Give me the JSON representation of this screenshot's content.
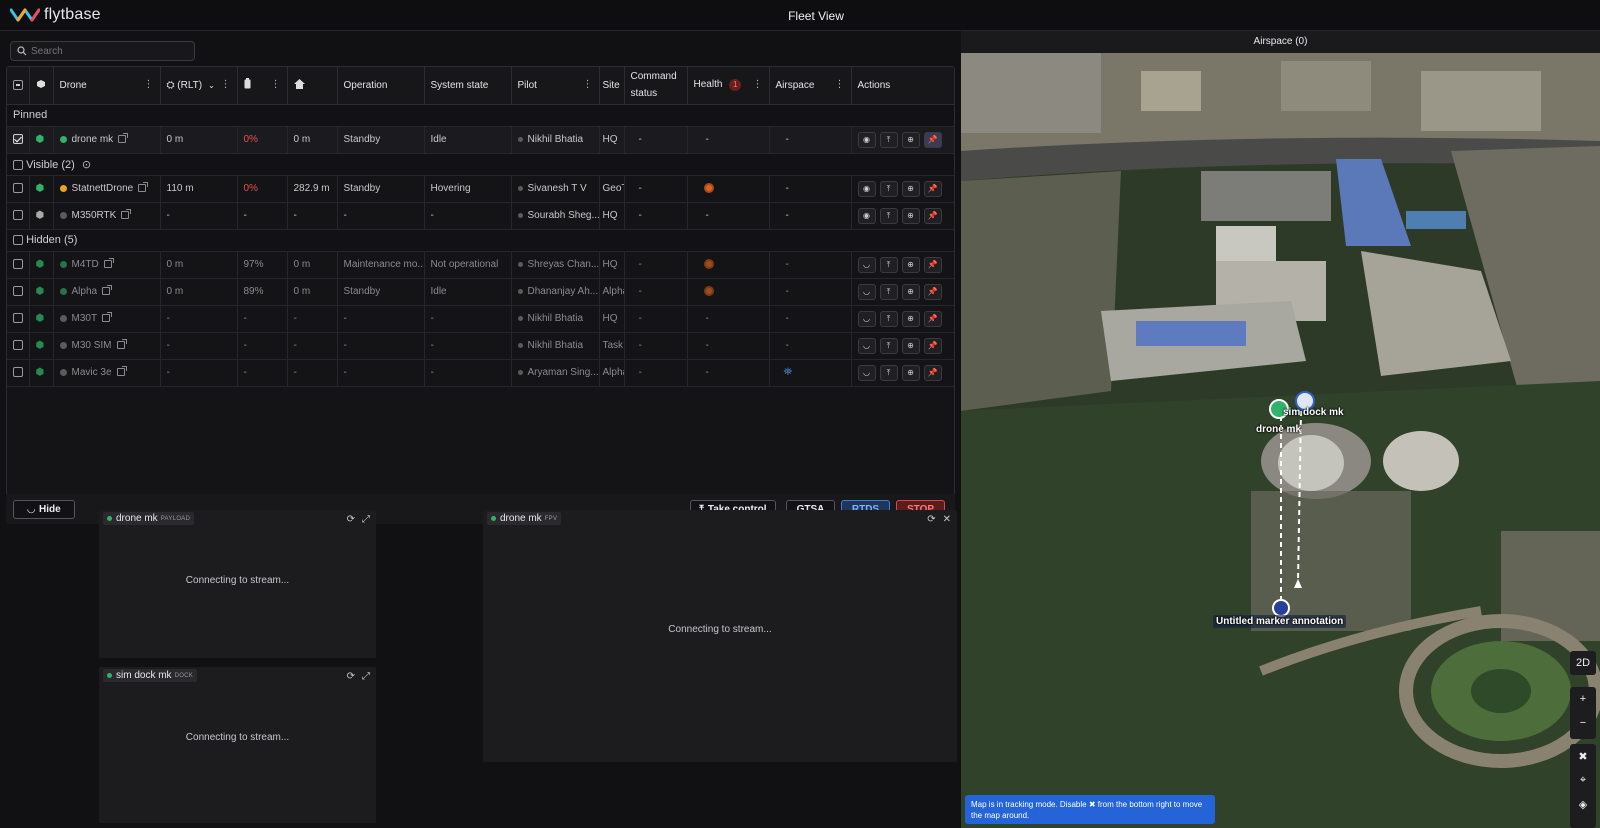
{
  "app": {
    "brand": "flytbase",
    "title": "Fleet View"
  },
  "search": {
    "placeholder": "Search"
  },
  "table": {
    "headers": {
      "drone": "Drone",
      "altitude": "(RLT)",
      "operation": "Operation",
      "system_state": "System state",
      "pilot": "Pilot",
      "site": "Site",
      "command_status": "Command status",
      "health": "Health",
      "health_badge": "1",
      "airspace": "Airspace",
      "actions": "Actions"
    },
    "groups": {
      "pinned": "Pinned",
      "visible": "Visible (2)",
      "hidden": "Hidden (5)"
    },
    "pinned_rows": [
      {
        "name": "drone mk",
        "alt": "0 m",
        "battery": "0%",
        "home": "0 m",
        "operation": "Standby",
        "state": "Idle",
        "pilot": "Nikhil Bhatia",
        "site": "HQ",
        "command": "-",
        "health": "-",
        "airspace": "-"
      }
    ],
    "visible_rows": [
      {
        "name": "StatnettDrone",
        "alt": "110 m",
        "battery": "0%",
        "home": "282.9 m",
        "operation": "Standby",
        "state": "Hovering",
        "pilot": "Sivanesh T V",
        "site": "GeoT",
        "command": "-",
        "health": "",
        "airspace": "-"
      },
      {
        "name": "M350RTK",
        "alt": "-",
        "battery": "-",
        "home": "-",
        "operation": "-",
        "state": "-",
        "pilot": "Sourabh Sheg...",
        "site": "HQ",
        "command": "-",
        "health": "-",
        "airspace": "-"
      }
    ],
    "hidden_rows": [
      {
        "name": "M4TD",
        "alt": "0 m",
        "battery": "97%",
        "home": "0 m",
        "operation": "Maintenance mo...",
        "state": "Not operational",
        "pilot": "Shreyas Chan...",
        "site": "HQ",
        "command": "-",
        "health": "",
        "airspace": "-"
      },
      {
        "name": "Alpha",
        "alt": "0 m",
        "battery": "89%",
        "home": "0 m",
        "operation": "Standby",
        "state": "Idle",
        "pilot": "Dhananjay Ah...",
        "site": "Alpha",
        "command": "-",
        "health": "",
        "airspace": "-"
      },
      {
        "name": "M30T",
        "alt": "-",
        "battery": "-",
        "home": "-",
        "operation": "-",
        "state": "-",
        "pilot": "Nikhil Bhatia",
        "site": "HQ",
        "command": "-",
        "health": "-",
        "airspace": "-"
      },
      {
        "name": "M30 SIM",
        "alt": "-",
        "battery": "-",
        "home": "-",
        "operation": "-",
        "state": "-",
        "pilot": "Nikhil Bhatia",
        "site": "Task",
        "command": "-",
        "health": "-",
        "airspace": "-"
      },
      {
        "name": "Mavic 3e",
        "alt": "-",
        "battery": "-",
        "home": "-",
        "operation": "-",
        "state": "-",
        "pilot": "Aryaman Sing...",
        "site": "Alpha",
        "command": "-",
        "health": "-",
        "airspace": ""
      }
    ]
  },
  "controls": {
    "hide": "Hide",
    "take_control": "Take control",
    "gtsa": "GTSA",
    "rtds": "RTDS",
    "stop": "STOP"
  },
  "streams": [
    {
      "name": "drone mk",
      "tag": "PAYLOAD",
      "message": "Connecting to stream..."
    },
    {
      "name": "sim dock mk",
      "tag": "DOCK",
      "message": "Connecting to stream..."
    },
    {
      "name": "drone mk",
      "tag": "FPV",
      "message": "Connecting to stream..."
    }
  ],
  "map": {
    "header": "Airspace (0)",
    "labels": {
      "dock": "sim dock mk",
      "drone": "drone mk",
      "marker": "Untitled marker annotation"
    },
    "view_mode": "2D",
    "toast": "Map is in tracking mode. Disable ✖ from the bottom right to move the map around."
  }
}
